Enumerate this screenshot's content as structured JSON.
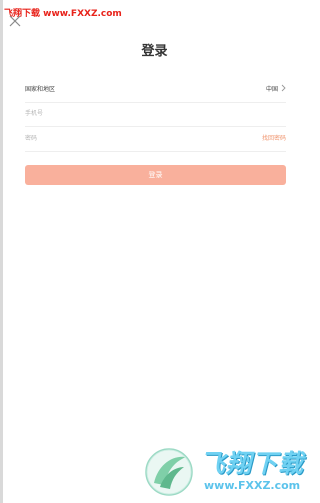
{
  "watermark_top": "飞翔下载 www.FXXZ.com",
  "page": {
    "title": "登录"
  },
  "form": {
    "region_label": "国家和地区",
    "region_value": "中国",
    "phone_placeholder": "手机号",
    "password_placeholder": "密码",
    "forgot_password": "找回密码",
    "login_button": "登录"
  },
  "logo_watermark": {
    "brand_cn": "飞翔下载",
    "url": "www.FXXZ.com"
  },
  "colors": {
    "accent_button": "#f9b09c",
    "forgot_link": "#f0956f",
    "watermark_red": "#e8231b",
    "logo_blue": "#6fd1f2"
  },
  "icons": {
    "close": "close-icon",
    "chevron": "chevron-right-icon"
  }
}
